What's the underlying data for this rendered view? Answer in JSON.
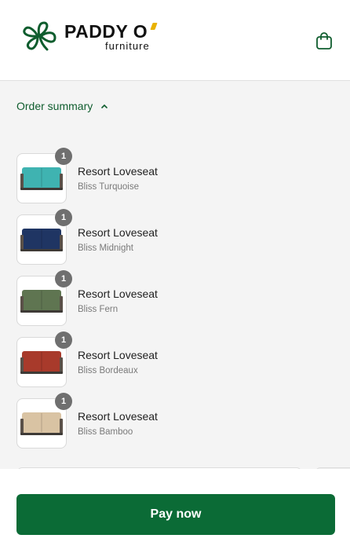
{
  "brand": {
    "name": "PADDY O",
    "tagline": "furniture",
    "logo_icon": "shamrock-icon",
    "accent_color": "#e9b200",
    "mark_color": "#0f5d2e"
  },
  "header": {
    "cart_icon": "shopping-bag-icon"
  },
  "order_summary": {
    "toggle_label": "Order summary",
    "toggle_icon": "chevron-up-icon",
    "items": [
      {
        "quantity": "1",
        "title": "Resort Loveseat",
        "variant": "Bliss Turquoise",
        "color": "#3fb3b1"
      },
      {
        "quantity": "1",
        "title": "Resort Loveseat",
        "variant": "Bliss Midnight",
        "color": "#1f3563"
      },
      {
        "quantity": "1",
        "title": "Resort Loveseat",
        "variant": "Bliss Fern",
        "color": "#5f7551"
      },
      {
        "quantity": "1",
        "title": "Resort Loveseat",
        "variant": "Bliss Bordeaux",
        "color": "#a83a2b"
      },
      {
        "quantity": "1",
        "title": "Resort Loveseat",
        "variant": "Bliss Bamboo",
        "color": "#d9c3a3"
      }
    ]
  },
  "checkout": {
    "pay_label": "Pay now",
    "pay_color": "#0b6b36"
  }
}
